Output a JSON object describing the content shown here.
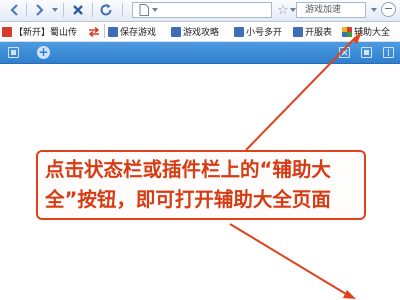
{
  "toolbar": {
    "back_icon": "back-arrow-icon",
    "forward_icon": "forward-arrow-icon",
    "stop_icon": "stop-x-icon",
    "refresh_icon": "refresh-icon",
    "page_icon": "page-icon",
    "search_box_text": "游戏加速",
    "zoom_out_label": "−",
    "colors": {
      "button_blue": "#4d7cc2",
      "toolbar_bg": "#e4ebf5"
    }
  },
  "favorites": {
    "items": [
      {
        "label": "【新开】蜀山传",
        "icon": "heart-icon",
        "color": "#d73b2c"
      },
      {
        "label": "保存游戏",
        "icon": "save-icon",
        "color": "#3e6fb6"
      },
      {
        "label": "游戏攻略",
        "icon": "guide-icon",
        "color": "#3e6fb6"
      },
      {
        "label": "小号多开",
        "icon": "multi-account-icon",
        "color": "#3e6fb6"
      },
      {
        "label": "开服表",
        "icon": "server-list-icon",
        "color": "#3e6fb6"
      },
      {
        "label": "辅助大全",
        "icon": "assistant-icon",
        "color": "#d73b2c"
      }
    ]
  },
  "tabbar": {
    "color": "#3a8ad7"
  },
  "annotation": {
    "line1": "点击状态栏或插件栏上的“辅助大",
    "line2": "全”按钮，即可打开辅助大全页面",
    "color": "#e0421b"
  }
}
